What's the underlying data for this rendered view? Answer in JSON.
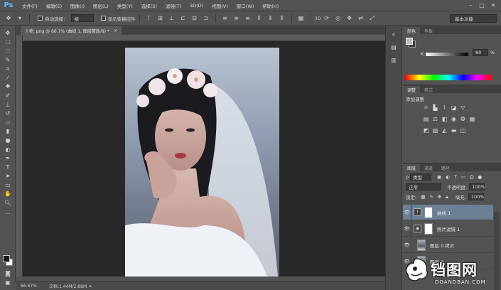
{
  "app": {
    "logo": "Ps"
  },
  "menu": [
    "文件(F)",
    "编辑(E)",
    "图像(I)",
    "图层(L)",
    "类型(Y)",
    "选择(S)",
    "滤镜(T)",
    "3D(D)",
    "视图(V)",
    "窗口(W)",
    "帮助(H)"
  ],
  "options": {
    "auto_select_label": "自动选择：",
    "auto_select_value": "组",
    "show_transform_label": "显示变换控件",
    "workspace": "基本功能"
  },
  "document": {
    "tab_title": "人物, png @ 66.7% (曲线 1, 图层蒙版/8) *",
    "zoom": "66.67%",
    "doc_info": "文档:1.44M/2.88M"
  },
  "color_panel": {
    "tabs": [
      "颜色",
      "色板"
    ],
    "channel": "K",
    "value": "80",
    "unit": "%",
    "fg_color": "#bcbcbc",
    "bg_color": "#3a3a3a"
  },
  "adjust_panel": {
    "tabs": [
      "调整",
      "样式"
    ],
    "title": "添加调整"
  },
  "layers_panel": {
    "tabs": [
      "图层",
      "通道",
      "路径"
    ],
    "filter": "类型",
    "blend_mode": "正常",
    "opacity_label": "不透明度:",
    "opacity": "100%",
    "lock_label": "锁定:",
    "fill_label": "填充:",
    "fill": "100%",
    "layers": [
      {
        "name": "曲线 1",
        "selected": true
      },
      {
        "name": "照片滤镜 1",
        "selected": false
      },
      {
        "name": "图层 0 拷贝",
        "selected": false
      },
      {
        "name": "图层 0",
        "selected": false
      }
    ]
  },
  "watermark": {
    "text": "铛图网",
    "url": "DOANDBAN.COM"
  }
}
